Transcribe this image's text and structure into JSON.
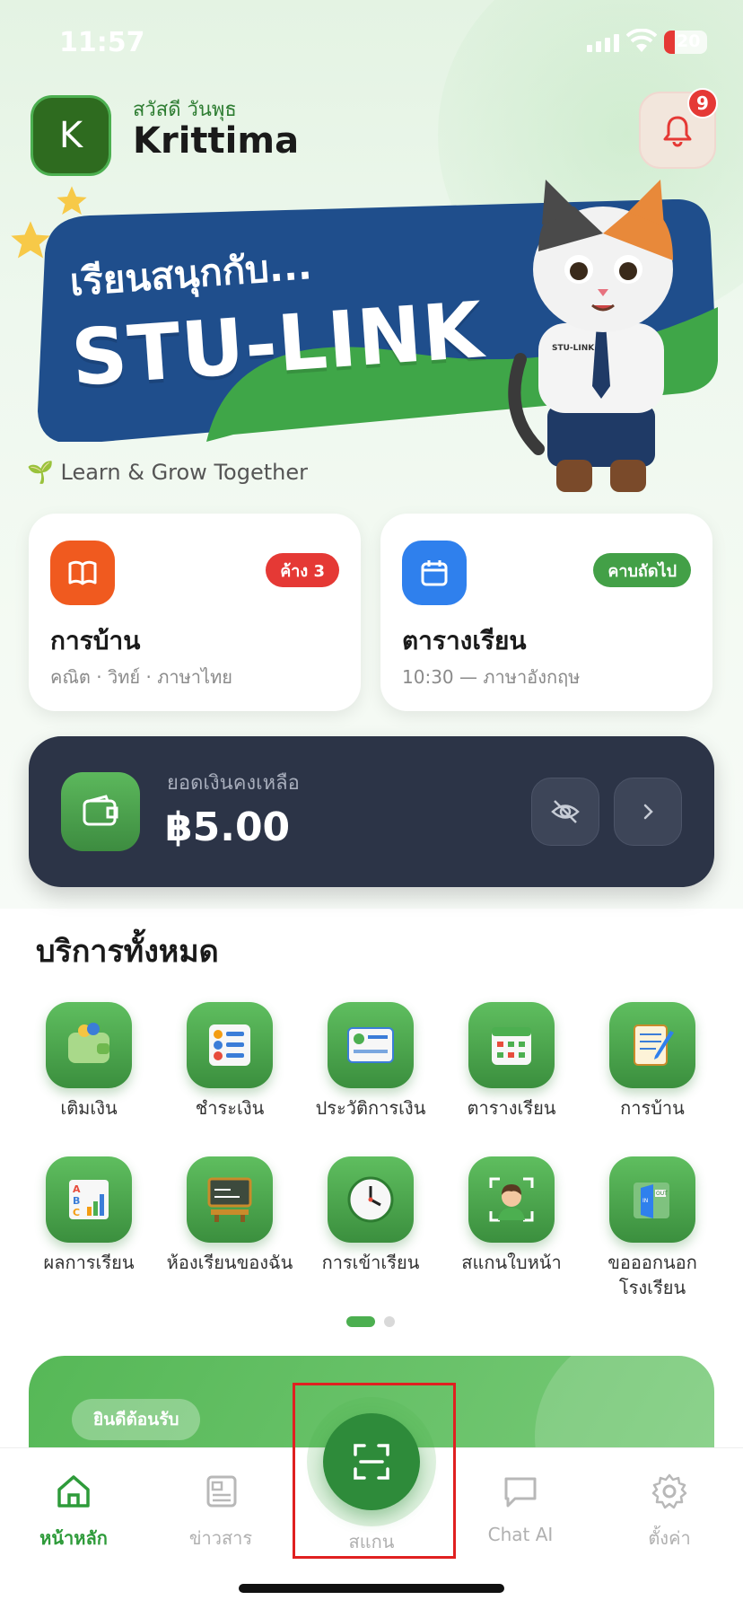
{
  "status_bar": {
    "time": "11:57",
    "battery": "20"
  },
  "header": {
    "avatar_letter": "K",
    "greeting": "สวัสดี วันพุธ",
    "name": "Krittima",
    "notification_count": "9"
  },
  "banner": {
    "line1": "เรียนสนุกกับ...",
    "line2": "STU-LINK",
    "mascot_shirt_text": "STU-LINK",
    "tagline": "🌱 Learn & Grow Together"
  },
  "cards": [
    {
      "title": "การบ้าน",
      "subtitle": "คณิต · วิทย์ · ภาษาไทย",
      "badge": "ค้าง 3",
      "badge_color": "#e53935",
      "icon": "book-icon",
      "icon_color": "#f05a1f"
    },
    {
      "title": "ตารางเรียน",
      "subtitle": "10:30 — ภาษาอังกฤษ",
      "badge": "คาบถัดไป",
      "badge_color": "#43a047",
      "icon": "calendar-icon",
      "icon_color": "#2f80ed"
    }
  ],
  "balance": {
    "label": "ยอดเงินคงเหลือ",
    "amount": "฿5.00"
  },
  "services": {
    "title": "บริการทั้งหมด",
    "items": [
      {
        "label": "เติมเงิน",
        "icon": "wallet-topup-icon"
      },
      {
        "label": "ชำระเงิน",
        "icon": "payment-list-icon"
      },
      {
        "label": "ประวัติการเงิน",
        "icon": "finance-history-icon"
      },
      {
        "label": "ตารางเรียน",
        "icon": "timetable-icon"
      },
      {
        "label": "การบ้าน",
        "icon": "homework-notebook-icon"
      },
      {
        "label": "ผลการเรียน",
        "icon": "grades-chart-icon"
      },
      {
        "label": "ห้องเรียนของฉัน",
        "icon": "classroom-board-icon"
      },
      {
        "label": "การเข้าเรียน",
        "icon": "attendance-clock-icon"
      },
      {
        "label": "สแกนใบหน้า",
        "icon": "face-scan-icon"
      },
      {
        "label": "ขอออกนอกโรงเรียน",
        "icon": "exit-door-icon"
      }
    ]
  },
  "welcome": {
    "pill": "ยินดีต้อนรับ"
  },
  "bottom_nav": [
    {
      "label": "หน้าหลัก",
      "icon": "home-icon",
      "active": true
    },
    {
      "label": "ข่าวสาร",
      "icon": "news-icon",
      "active": false
    },
    {
      "label": "สแกน",
      "icon": "scan-icon",
      "active": false
    },
    {
      "label": "Chat AI",
      "icon": "chat-icon",
      "active": false
    },
    {
      "label": "ตั้งค่า",
      "icon": "settings-gear-icon",
      "active": false
    }
  ],
  "colors": {
    "primary_green": "#2e8b3a",
    "balance_bg": "#2c3447",
    "banner_blue": "#1f4e8c",
    "highlight_red": "#e02020"
  }
}
